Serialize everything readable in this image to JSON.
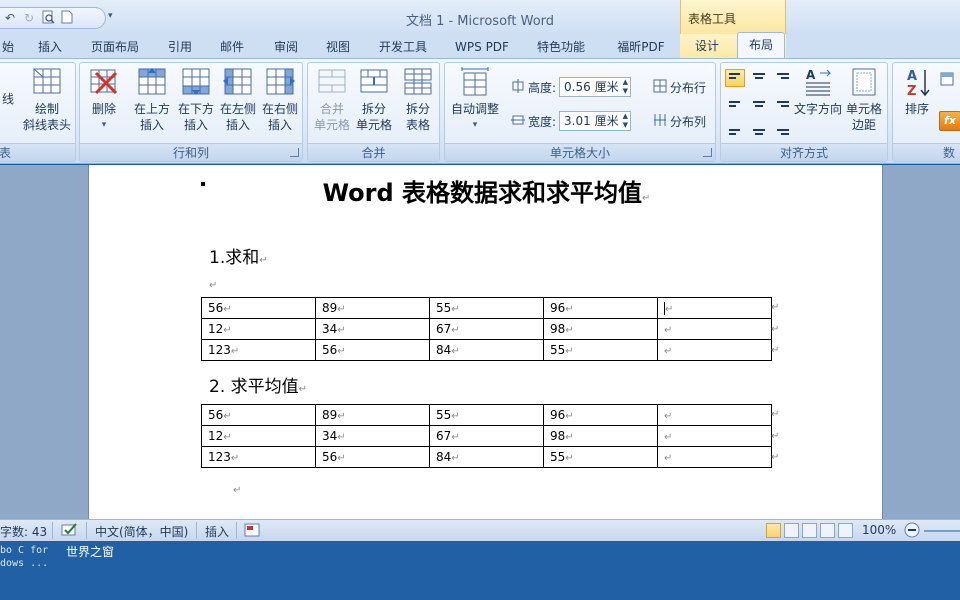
{
  "window": {
    "title": "文档 1 - Microsoft Word",
    "context_tab_group": "表格工具"
  },
  "qat": {
    "undo_icon": "undo-icon",
    "redo_icon": "redo-icon",
    "print_preview_icon": "print-preview-icon",
    "new_doc_icon": "new-document-icon"
  },
  "tabs": [
    {
      "label": "始"
    },
    {
      "label": "插入"
    },
    {
      "label": "页面布局"
    },
    {
      "label": "引用"
    },
    {
      "label": "邮件"
    },
    {
      "label": "审阅"
    },
    {
      "label": "视图"
    },
    {
      "label": "开发工具"
    },
    {
      "label": "WPS PDF"
    },
    {
      "label": "特色功能"
    },
    {
      "label": "福昕PDF"
    },
    {
      "label": "设计"
    },
    {
      "label": "布局"
    }
  ],
  "ribbon": {
    "draw_group": {
      "label": "表",
      "btn_partial": "线",
      "btn_draw_diag_l1": "绘制",
      "btn_draw_diag_l2": "斜线表头"
    },
    "rows_cols": {
      "label": "行和列",
      "delete": "删除",
      "insert_above_l1": "在上方",
      "insert_above_l2": "插入",
      "insert_below_l1": "在下方",
      "insert_below_l2": "插入",
      "insert_left_l1": "在左侧",
      "insert_left_l2": "插入",
      "insert_right_l1": "在右侧",
      "insert_right_l2": "插入"
    },
    "merge": {
      "label": "合并",
      "merge_cells_l1": "合并",
      "merge_cells_l2": "单元格",
      "split_cells_l1": "拆分",
      "split_cells_l2": "单元格",
      "split_table_l1": "拆分",
      "split_table_l2": "表格"
    },
    "cell_size": {
      "label": "单元格大小",
      "autofit": "自动调整",
      "height_label": "高度:",
      "height_value": "0.56 厘米",
      "width_label": "宽度:",
      "width_value": "3.01 厘米",
      "distribute_rows": "分布行",
      "distribute_cols": "分布列"
    },
    "alignment": {
      "label": "对齐方式",
      "text_direction": "文字方向",
      "cell_margins_l1": "单元格",
      "cell_margins_l2": "边距"
    },
    "data": {
      "label": "数",
      "sort": "排序"
    }
  },
  "document": {
    "title": "Word 表格数据求和求平均值",
    "section1": "1.求和",
    "section2": "2. 求平均值",
    "para_mark": "↵",
    "table1": [
      [
        "56",
        "89",
        "55",
        "96",
        ""
      ],
      [
        "12",
        "34",
        "67",
        "98",
        ""
      ],
      [
        "123",
        "56",
        "84",
        "55",
        ""
      ]
    ],
    "table2": [
      [
        "56",
        "89",
        "55",
        "96",
        ""
      ],
      [
        "12",
        "34",
        "67",
        "98",
        ""
      ],
      [
        "123",
        "56",
        "84",
        "55",
        ""
      ]
    ]
  },
  "statusbar": {
    "word_count": "字数: 43",
    "language": "中文(简体，中国)",
    "insert_mode": "插入",
    "zoom": "100%"
  },
  "taskbar": {
    "program_line1": "bo C for",
    "program_line2": "dows ...",
    "item": "世界之窗"
  },
  "colors": {
    "ribbon_bg": "#dce8f6",
    "context_tab": "#fde9a8",
    "selected_accent": "#fcd06f",
    "taskbar": "#2160a4"
  }
}
